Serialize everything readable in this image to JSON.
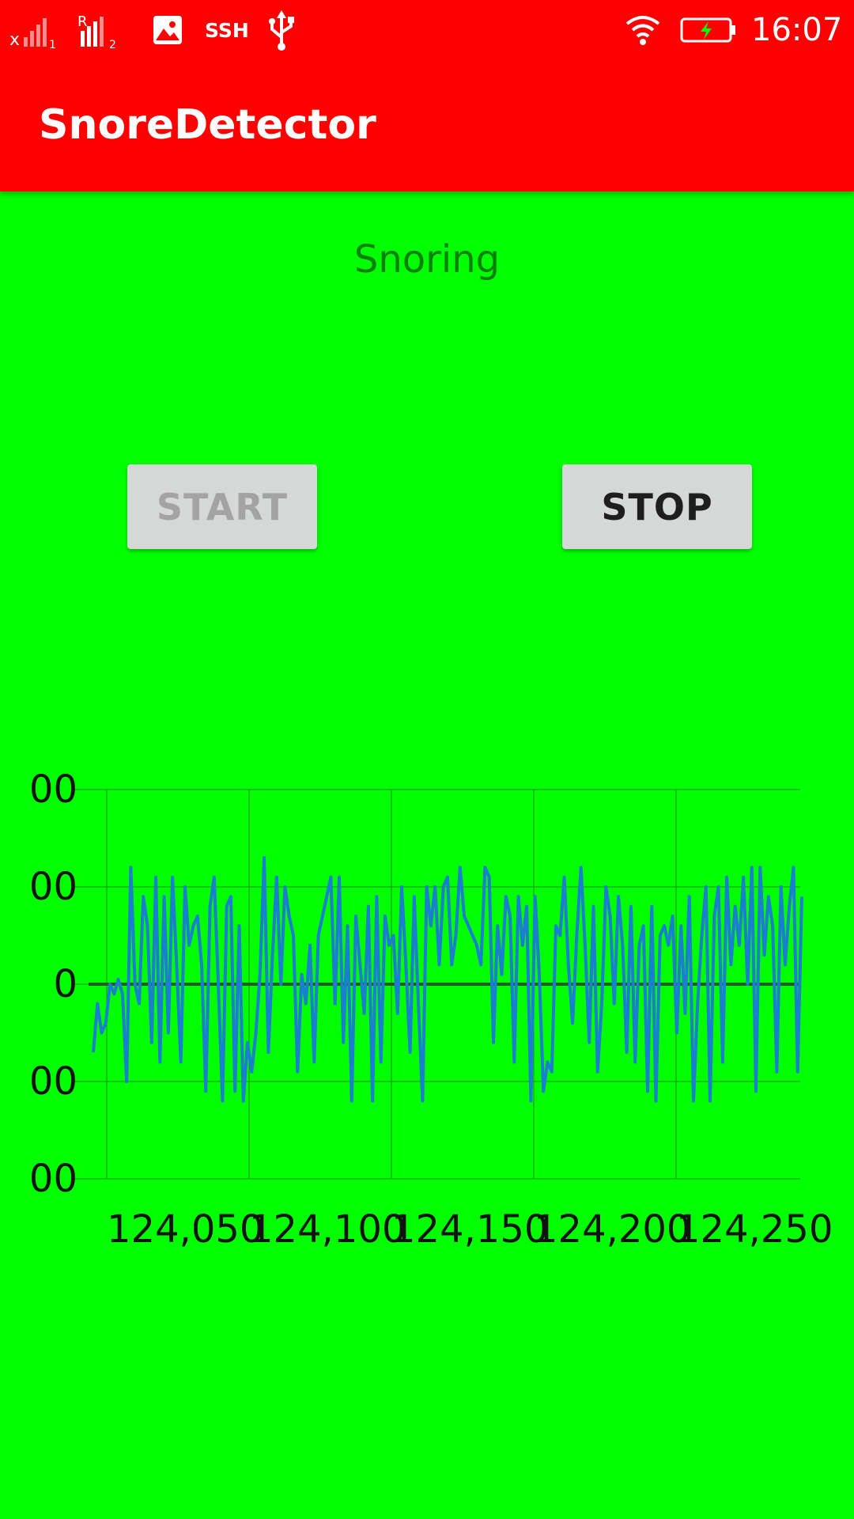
{
  "status_bar": {
    "ssh_label": "SSH",
    "time": "16:07",
    "sim1_marker": "1",
    "sim2_marker": "2",
    "roaming_marker": "R",
    "no_signal_marker": "x",
    "icons": [
      "signal-sim1-icon",
      "signal-sim2-icon",
      "image-notification-icon",
      "usb-icon",
      "wifi-icon",
      "battery-charging-icon"
    ]
  },
  "app_bar": {
    "title": "SnoreDetector"
  },
  "main": {
    "status_text": "Snoring",
    "start_label": "START",
    "stop_label": "STOP"
  },
  "colors": {
    "background": "#00ff00",
    "bars": "#ff0000",
    "line": "#1b7fd0",
    "status_text": "#0a7f0a"
  },
  "chart_data": {
    "type": "line",
    "yticks": [
      "00",
      "00",
      "0",
      "00",
      "00"
    ],
    "xticks": [
      "124,050",
      "124,100",
      "124,150",
      "124,200",
      "124,250"
    ],
    "ylim": [
      -2,
      2
    ],
    "grid": true,
    "zero_line": true,
    "series": [
      {
        "color": "#1b7fd0",
        "values": [
          -0.7,
          -0.2,
          -0.5,
          -0.4,
          0.0,
          -0.1,
          0.05,
          -0.1,
          -1.0,
          1.2,
          0.0,
          -0.2,
          0.9,
          0.6,
          -0.6,
          1.1,
          -0.8,
          0.9,
          -0.5,
          1.1,
          0.2,
          -0.8,
          1.0,
          0.4,
          0.6,
          0.7,
          0.2,
          -1.1,
          0.8,
          1.1,
          0.0,
          -1.2,
          0.8,
          0.9,
          -1.1,
          0.6,
          -1.2,
          -0.6,
          -0.9,
          -0.5,
          0.1,
          1.3,
          -0.7,
          0.3,
          1.1,
          0.0,
          1.0,
          0.7,
          0.5,
          -0.9,
          0.1,
          -0.2,
          0.4,
          -0.8,
          0.5,
          0.7,
          0.9,
          1.1,
          -0.2,
          1.1,
          -0.6,
          0.6,
          -1.2,
          0.7,
          0.2,
          -0.3,
          0.8,
          -1.2,
          0.9,
          -0.8,
          0.7,
          0.4,
          0.5,
          -0.3,
          1.0,
          0.2,
          -0.7,
          0.9,
          -0.2,
          -1.2,
          1.0,
          0.6,
          1.0,
          0.2,
          1.0,
          1.1,
          0.2,
          0.5,
          1.2,
          0.7,
          0.6,
          0.5,
          0.4,
          0.2,
          1.2,
          1.1,
          -0.6,
          0.6,
          0.1,
          0.9,
          0.7,
          -0.8,
          0.9,
          0.4,
          0.8,
          -1.2,
          0.9,
          0.1,
          -1.1,
          -0.8,
          -0.9,
          0.6,
          0.5,
          1.1,
          0.2,
          -0.4,
          0.5,
          1.2,
          0.4,
          -0.6,
          0.8,
          -0.9,
          -0.2,
          1.0,
          0.7,
          -0.2,
          0.9,
          0.4,
          -0.7,
          0.8,
          -0.8,
          0.4,
          0.6,
          -1.1,
          0.8,
          -1.2,
          0.5,
          0.6,
          0.4,
          0.7,
          -0.5,
          0.6,
          -0.3,
          0.9,
          -1.2,
          -0.2,
          0.5,
          1.0,
          -1.2,
          0.7,
          1.0,
          -0.8,
          1.1,
          0.2,
          0.8,
          0.4,
          1.1,
          0.0,
          1.2,
          -1.1,
          1.2,
          0.3,
          0.9,
          0.6,
          -0.9,
          1.0,
          0.2,
          0.8,
          1.2,
          -0.9,
          0.9
        ]
      }
    ]
  }
}
